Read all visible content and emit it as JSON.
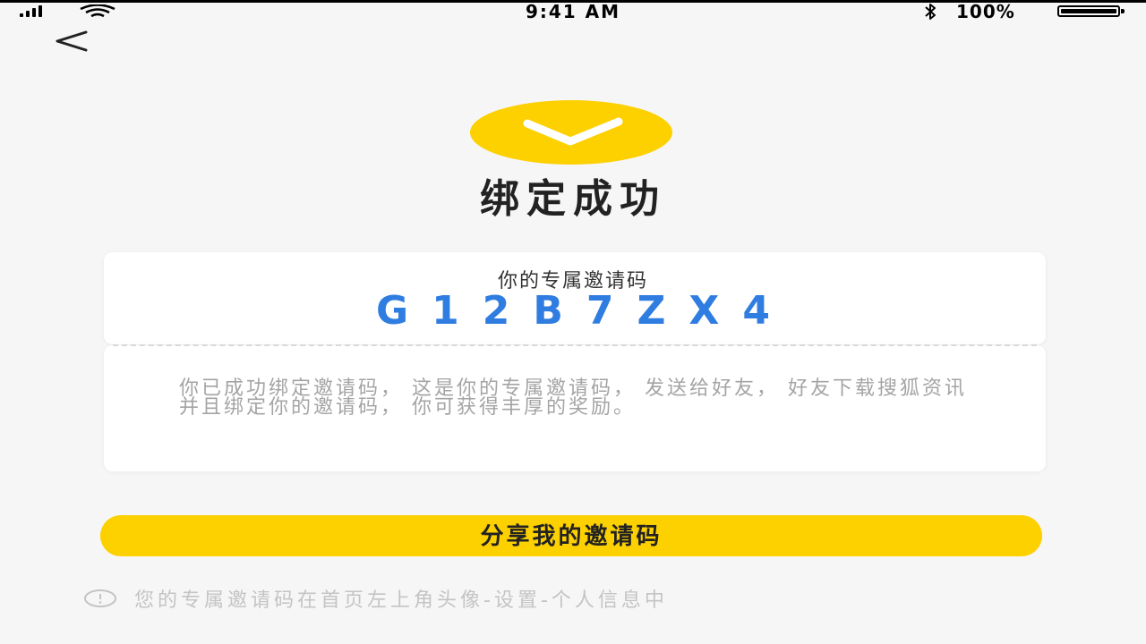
{
  "status_bar": {
    "time": "9:41 AM",
    "battery": "100%",
    "icons": [
      "signal-icon",
      "wifi-icon",
      "bluetooth-icon",
      "battery-icon"
    ]
  },
  "nav": {
    "back_icon": "chevron-left-icon"
  },
  "success": {
    "icon": "checkmark-icon",
    "title": "绑定成功",
    "accent_color": "#fdd000"
  },
  "invite": {
    "label": "你的专属邀请码",
    "code": "G12B7ZX4",
    "code_color": "#2f7de1",
    "description": "你已成功绑定邀请码， 这是你的专属邀请码， 发送给好友， 好友下载搜狐资讯并且绑定你的邀请码， 你可获得丰厚的奖励。"
  },
  "actions": {
    "share_label": "分享我的邀请码"
  },
  "hint": {
    "icon": "info-icon",
    "text": "您的专属邀请码在首页左上角头像-设置-个人信息中"
  }
}
